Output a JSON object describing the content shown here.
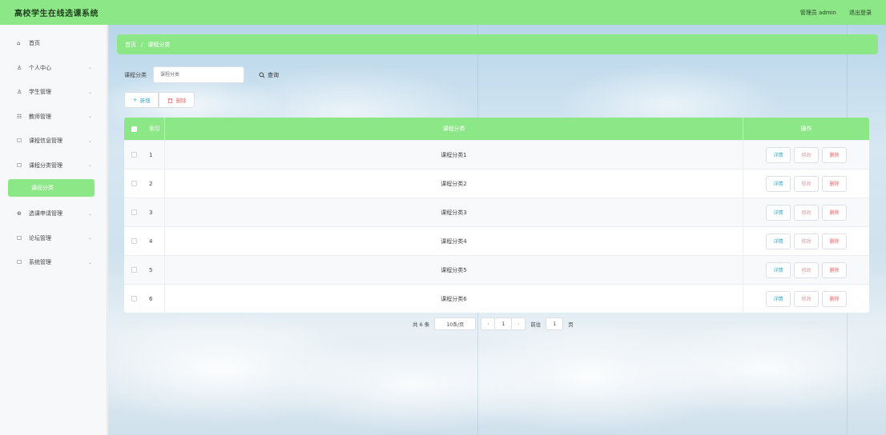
{
  "header": {
    "title": "高校学生在线选课系统",
    "user": "管理员 admin",
    "logout": "退出登录"
  },
  "sidebar": {
    "items": [
      {
        "icon": "⌂",
        "label": "首页"
      },
      {
        "icon": "♙",
        "label": "个人中心",
        "chevron": "⌄"
      },
      {
        "icon": "♙",
        "label": "学生管理",
        "chevron": "⌄"
      },
      {
        "icon": "☷",
        "label": "教师管理",
        "chevron": "⌄"
      },
      {
        "icon": "☐",
        "label": "课程信息管理",
        "chevron": "⌄"
      },
      {
        "icon": "☐",
        "label": "课程分类管理",
        "chevron": "⌄"
      }
    ],
    "active_sub": "课程分类",
    "items2": [
      {
        "icon": "⊕",
        "label": "选课申请管理",
        "chevron": "⌄"
      },
      {
        "icon": "☐",
        "label": "论坛管理",
        "chevron": "⌄"
      },
      {
        "icon": "☐",
        "label": "系统管理",
        "chevron": "⌄"
      }
    ]
  },
  "breadcrumb": {
    "home": "首页",
    "sep": "/",
    "current": "课程分类"
  },
  "search": {
    "label": "课程分类",
    "placeholder": "课程分类",
    "button": "查询"
  },
  "actions": {
    "add": "新增",
    "delete": "删除"
  },
  "table": {
    "headers": {
      "index": "索引",
      "name": "课程分类",
      "ops": "操作"
    },
    "rows": [
      {
        "index": "1",
        "name": "课程分类1"
      },
      {
        "index": "2",
        "name": "课程分类2"
      },
      {
        "index": "3",
        "name": "课程分类3"
      },
      {
        "index": "4",
        "name": "课程分类4"
      },
      {
        "index": "5",
        "name": "课程分类5"
      },
      {
        "index": "6",
        "name": "课程分类6"
      }
    ],
    "ops": {
      "detail": "详情",
      "edit": "修改",
      "delete": "删除"
    }
  },
  "pagination": {
    "total": "共 6 条",
    "page_size": "10条/页",
    "prev": "‹",
    "current": "1",
    "next": "›",
    "goto": "前往",
    "page_input": "1",
    "page_unit": "页"
  },
  "colors": {
    "accent": "#8ce887"
  }
}
